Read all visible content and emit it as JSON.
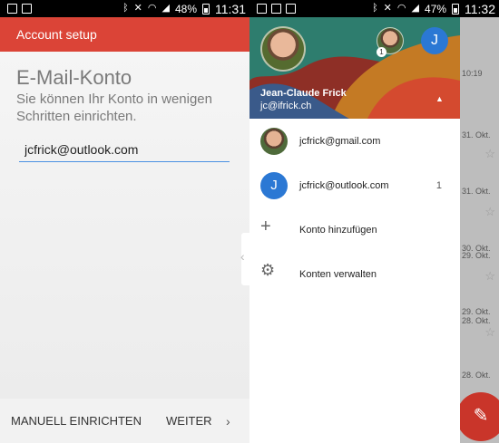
{
  "left": {
    "status": {
      "battery": "48%",
      "clock": "11:31"
    },
    "appbar_title": "Account setup",
    "title": "E-Mail-Konto",
    "subtitle": "Sie können Ihr Konto in wenigen Schritten einrichten.",
    "email_value": "jcfrick@outlook.com",
    "manual_label": "MANUELL EINRICHTEN",
    "next_label": "WEITER",
    "next_icon": "chevron-right-icon",
    "accent_color": "#db4437",
    "field_underline_color": "#4a90e2"
  },
  "right": {
    "status": {
      "battery": "47%",
      "clock": "11:32"
    },
    "header": {
      "name": "Jean-Claude Frick",
      "email": "jc@ifrick.ch",
      "account_initial": "J",
      "badge": "1"
    },
    "items": [
      {
        "label": "jcfrick@gmail.com",
        "icon": "avatar-photo",
        "count": ""
      },
      {
        "label": "jcfrick@outlook.com",
        "icon": "avatar-initial",
        "initial": "J",
        "count": "1"
      },
      {
        "label": "Konto hinzufügen",
        "icon": "plus-icon",
        "count": ""
      },
      {
        "label": "Konten verwalten",
        "icon": "gear-icon",
        "count": ""
      }
    ],
    "background_dates": [
      "10:19",
      "31. Okt.",
      "31. Okt.",
      "30. Okt.",
      "29. Okt.",
      "29. Okt.",
      "28. Okt.",
      "28. Okt."
    ],
    "fab_icon": "pencil-icon",
    "fab_color": "#c9352a"
  }
}
